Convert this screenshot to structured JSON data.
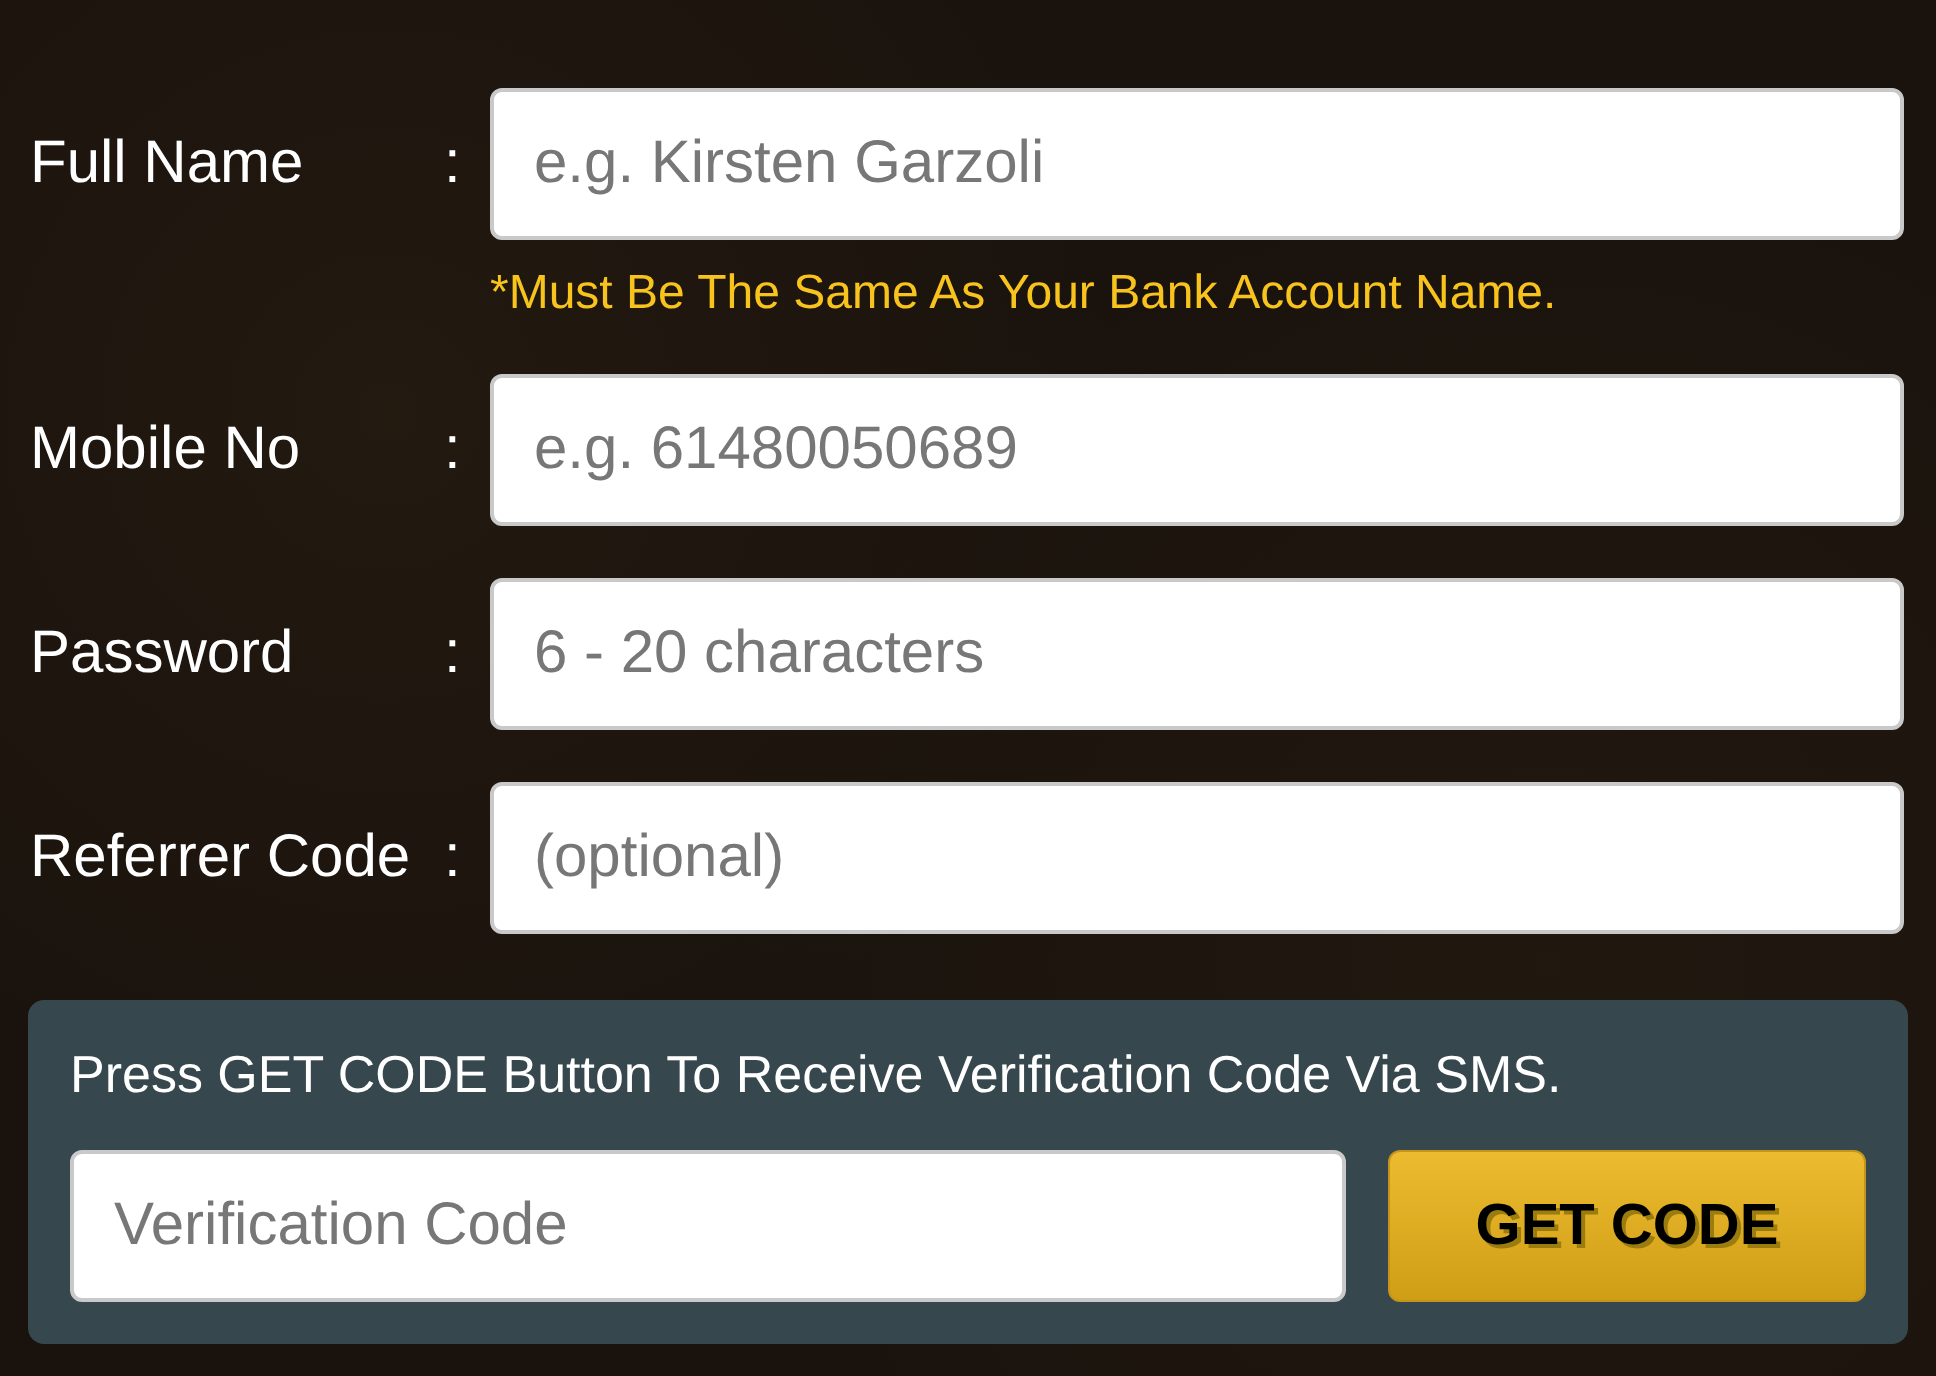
{
  "fields": [
    {
      "label": "Full Name",
      "separator": ":",
      "placeholder": "e.g. Kirsten Garzoli",
      "hint": "*Must Be The Same As Your Bank Account Name."
    },
    {
      "label": "Mobile No",
      "separator": ":",
      "placeholder": "e.g. 61480050689"
    },
    {
      "label": "Password",
      "separator": ":",
      "placeholder": "6 - 20 characters"
    },
    {
      "label": "Referrer Code",
      "separator": ":",
      "placeholder": "(optional)"
    }
  ],
  "verification": {
    "instruction": "Press GET CODE Button To Receive Verification Code Via SMS.",
    "placeholder": "Verification Code",
    "button": "GET CODE"
  }
}
